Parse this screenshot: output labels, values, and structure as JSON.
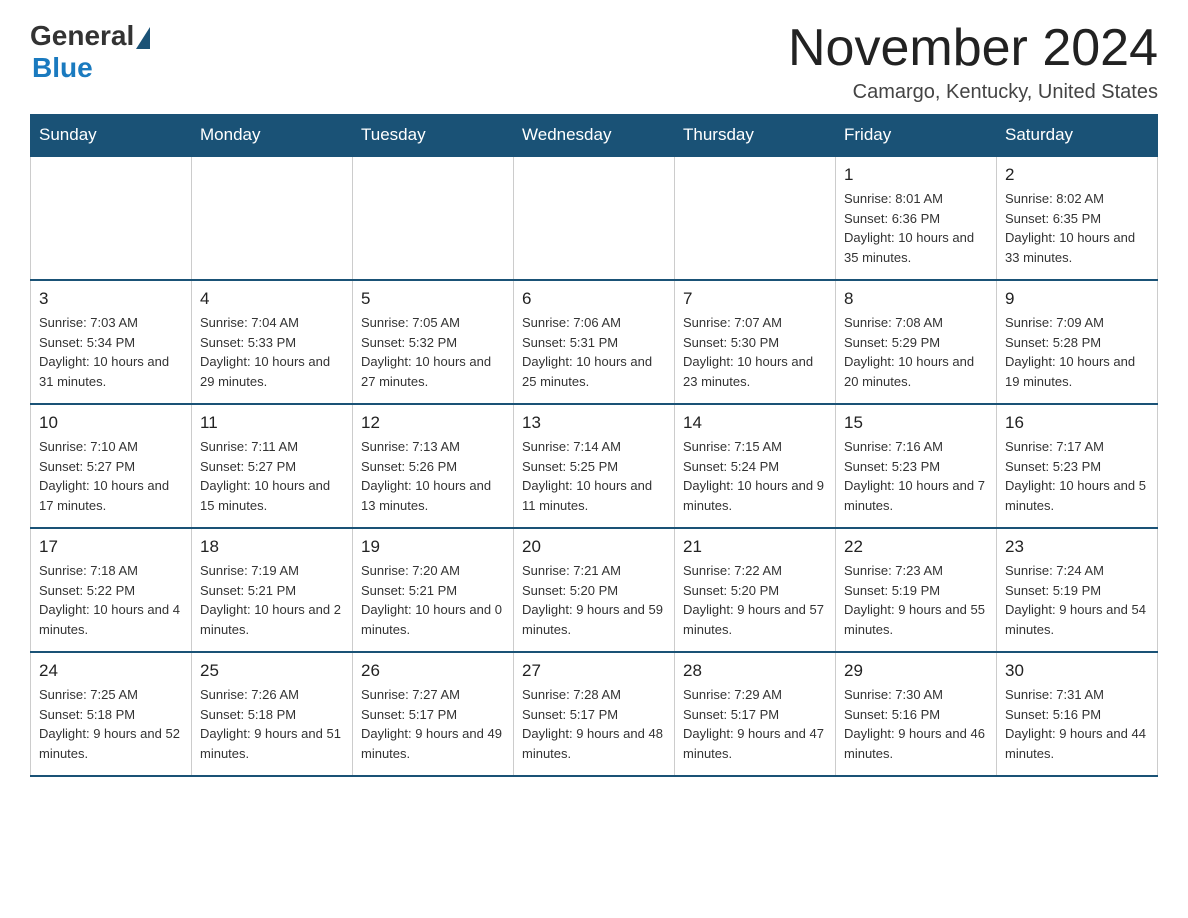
{
  "header": {
    "logo": {
      "general": "General",
      "blue": "Blue"
    },
    "title": "November 2024",
    "location": "Camargo, Kentucky, United States"
  },
  "calendar": {
    "days_of_week": [
      "Sunday",
      "Monday",
      "Tuesday",
      "Wednesday",
      "Thursday",
      "Friday",
      "Saturday"
    ],
    "weeks": [
      {
        "days": [
          {
            "number": "",
            "empty": true
          },
          {
            "number": "",
            "empty": true
          },
          {
            "number": "",
            "empty": true
          },
          {
            "number": "",
            "empty": true
          },
          {
            "number": "",
            "empty": true
          },
          {
            "number": "1",
            "sunrise": "8:01 AM",
            "sunset": "6:36 PM",
            "daylight": "10 hours and 35 minutes."
          },
          {
            "number": "2",
            "sunrise": "8:02 AM",
            "sunset": "6:35 PM",
            "daylight": "10 hours and 33 minutes."
          }
        ]
      },
      {
        "days": [
          {
            "number": "3",
            "sunrise": "7:03 AM",
            "sunset": "5:34 PM",
            "daylight": "10 hours and 31 minutes."
          },
          {
            "number": "4",
            "sunrise": "7:04 AM",
            "sunset": "5:33 PM",
            "daylight": "10 hours and 29 minutes."
          },
          {
            "number": "5",
            "sunrise": "7:05 AM",
            "sunset": "5:32 PM",
            "daylight": "10 hours and 27 minutes."
          },
          {
            "number": "6",
            "sunrise": "7:06 AM",
            "sunset": "5:31 PM",
            "daylight": "10 hours and 25 minutes."
          },
          {
            "number": "7",
            "sunrise": "7:07 AM",
            "sunset": "5:30 PM",
            "daylight": "10 hours and 23 minutes."
          },
          {
            "number": "8",
            "sunrise": "7:08 AM",
            "sunset": "5:29 PM",
            "daylight": "10 hours and 20 minutes."
          },
          {
            "number": "9",
            "sunrise": "7:09 AM",
            "sunset": "5:28 PM",
            "daylight": "10 hours and 19 minutes."
          }
        ]
      },
      {
        "days": [
          {
            "number": "10",
            "sunrise": "7:10 AM",
            "sunset": "5:27 PM",
            "daylight": "10 hours and 17 minutes."
          },
          {
            "number": "11",
            "sunrise": "7:11 AM",
            "sunset": "5:27 PM",
            "daylight": "10 hours and 15 minutes."
          },
          {
            "number": "12",
            "sunrise": "7:13 AM",
            "sunset": "5:26 PM",
            "daylight": "10 hours and 13 minutes."
          },
          {
            "number": "13",
            "sunrise": "7:14 AM",
            "sunset": "5:25 PM",
            "daylight": "10 hours and 11 minutes."
          },
          {
            "number": "14",
            "sunrise": "7:15 AM",
            "sunset": "5:24 PM",
            "daylight": "10 hours and 9 minutes."
          },
          {
            "number": "15",
            "sunrise": "7:16 AM",
            "sunset": "5:23 PM",
            "daylight": "10 hours and 7 minutes."
          },
          {
            "number": "16",
            "sunrise": "7:17 AM",
            "sunset": "5:23 PM",
            "daylight": "10 hours and 5 minutes."
          }
        ]
      },
      {
        "days": [
          {
            "number": "17",
            "sunrise": "7:18 AM",
            "sunset": "5:22 PM",
            "daylight": "10 hours and 4 minutes."
          },
          {
            "number": "18",
            "sunrise": "7:19 AM",
            "sunset": "5:21 PM",
            "daylight": "10 hours and 2 minutes."
          },
          {
            "number": "19",
            "sunrise": "7:20 AM",
            "sunset": "5:21 PM",
            "daylight": "10 hours and 0 minutes."
          },
          {
            "number": "20",
            "sunrise": "7:21 AM",
            "sunset": "5:20 PM",
            "daylight": "9 hours and 59 minutes."
          },
          {
            "number": "21",
            "sunrise": "7:22 AM",
            "sunset": "5:20 PM",
            "daylight": "9 hours and 57 minutes."
          },
          {
            "number": "22",
            "sunrise": "7:23 AM",
            "sunset": "5:19 PM",
            "daylight": "9 hours and 55 minutes."
          },
          {
            "number": "23",
            "sunrise": "7:24 AM",
            "sunset": "5:19 PM",
            "daylight": "9 hours and 54 minutes."
          }
        ]
      },
      {
        "days": [
          {
            "number": "24",
            "sunrise": "7:25 AM",
            "sunset": "5:18 PM",
            "daylight": "9 hours and 52 minutes."
          },
          {
            "number": "25",
            "sunrise": "7:26 AM",
            "sunset": "5:18 PM",
            "daylight": "9 hours and 51 minutes."
          },
          {
            "number": "26",
            "sunrise": "7:27 AM",
            "sunset": "5:17 PM",
            "daylight": "9 hours and 49 minutes."
          },
          {
            "number": "27",
            "sunrise": "7:28 AM",
            "sunset": "5:17 PM",
            "daylight": "9 hours and 48 minutes."
          },
          {
            "number": "28",
            "sunrise": "7:29 AM",
            "sunset": "5:17 PM",
            "daylight": "9 hours and 47 minutes."
          },
          {
            "number": "29",
            "sunrise": "7:30 AM",
            "sunset": "5:16 PM",
            "daylight": "9 hours and 46 minutes."
          },
          {
            "number": "30",
            "sunrise": "7:31 AM",
            "sunset": "5:16 PM",
            "daylight": "9 hours and 44 minutes."
          }
        ]
      }
    ]
  }
}
